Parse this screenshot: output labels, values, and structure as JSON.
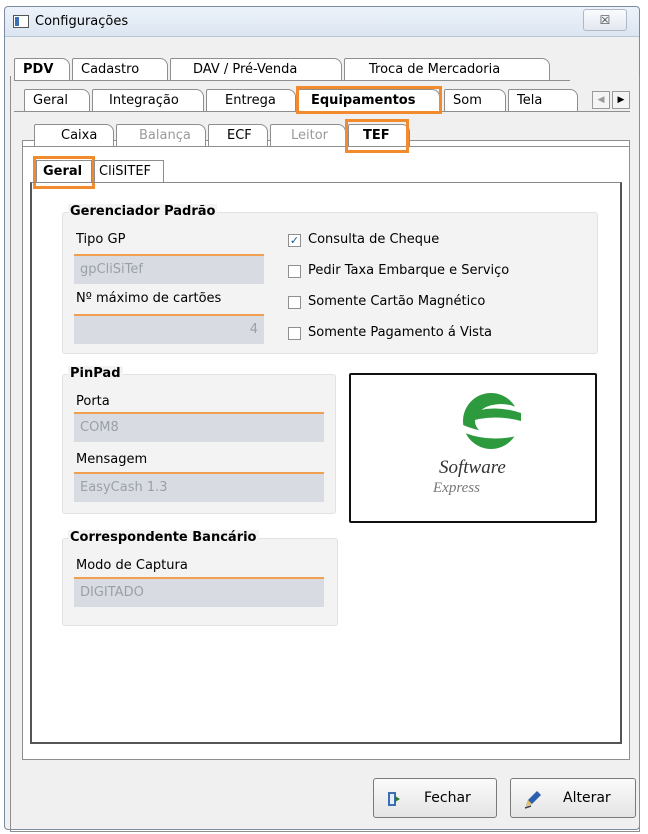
{
  "window": {
    "title": "Configurações",
    "close_glyph": "☒"
  },
  "tabs_row1": [
    {
      "label": "PDV"
    },
    {
      "label": "Cadastro"
    },
    {
      "label": "DAV / Pré-Venda"
    },
    {
      "label": "Troca de Mercadoria"
    }
  ],
  "tabs_row2": [
    {
      "label": "Geral"
    },
    {
      "label": "Integração"
    },
    {
      "label": "Entrega"
    },
    {
      "label": "Equipamentos"
    },
    {
      "label": "Som"
    },
    {
      "label": "Tela"
    }
  ],
  "tabs_row3": [
    {
      "label": "Caixa"
    },
    {
      "label": "Balança"
    },
    {
      "label": "ECF"
    },
    {
      "label": "Leitor"
    },
    {
      "label": "TEF"
    }
  ],
  "tabs_row4": [
    {
      "label": "Geral"
    },
    {
      "label": "CliSITEF"
    }
  ],
  "gerenciador": {
    "title": "Gerenciador Padrão",
    "tipo_gp_label": "Tipo GP",
    "tipo_gp_value": "gpCliSiTef",
    "max_cartoes_label": "Nº máximo de cartões",
    "max_cartoes_value": "4",
    "checks": [
      {
        "label": "Consulta de Cheque",
        "checked": true
      },
      {
        "label": "Pedir Taxa Embarque e Serviço",
        "checked": false
      },
      {
        "label": "Somente Cartão Magnético",
        "checked": false
      },
      {
        "label": "Somente Pagamento á Vista",
        "checked": false
      }
    ]
  },
  "pinpad": {
    "title": "PinPad",
    "porta_label": "Porta",
    "porta_value": "COM8",
    "mensagem_label": "Mensagem",
    "mensagem_value": "EasyCash 1.3"
  },
  "correspondente": {
    "title": "Correspondente Bancário",
    "modo_label": "Modo de Captura",
    "modo_value": "DIGITADO"
  },
  "logo": {
    "line1": "Software",
    "line2": "Express",
    "color_green": "#2e9a3e"
  },
  "buttons": {
    "fechar": "Fechar",
    "alterar": "Alterar"
  },
  "colors": {
    "highlight": "#f28a2e"
  }
}
